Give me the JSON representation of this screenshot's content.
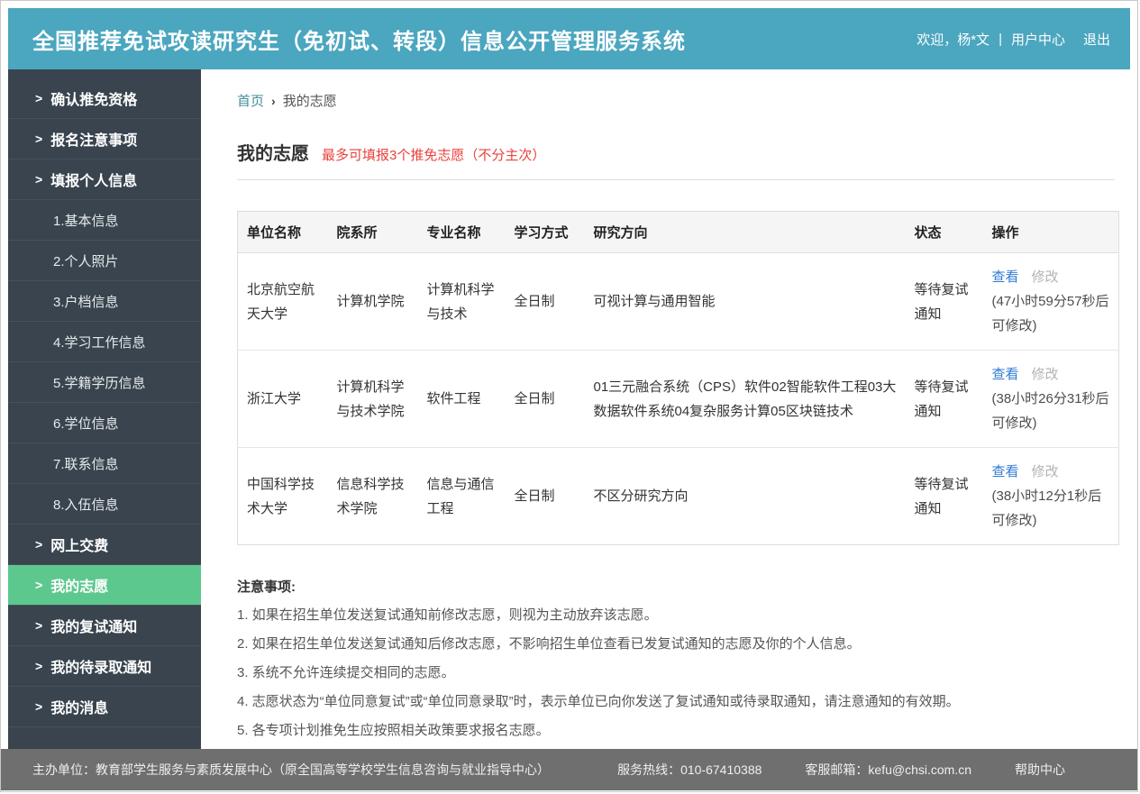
{
  "header": {
    "title": "全国推荐免试攻读研究生（免初试、转段）信息公开管理服务系统",
    "welcome": "欢迎，杨*文",
    "separator": "|",
    "user_center": "用户中心",
    "logout": "退出"
  },
  "sidebar": {
    "arrow": ">",
    "items": [
      {
        "label": "确认推免资格",
        "type": "top",
        "active": false
      },
      {
        "label": "报名注意事项",
        "type": "top",
        "active": false
      },
      {
        "label": "填报个人信息",
        "type": "top",
        "active": false
      },
      {
        "label": "1.基本信息",
        "type": "sub",
        "active": false
      },
      {
        "label": "2.个人照片",
        "type": "sub",
        "active": false
      },
      {
        "label": "3.户档信息",
        "type": "sub",
        "active": false
      },
      {
        "label": "4.学习工作信息",
        "type": "sub",
        "active": false
      },
      {
        "label": "5.学籍学历信息",
        "type": "sub",
        "active": false
      },
      {
        "label": "6.学位信息",
        "type": "sub",
        "active": false
      },
      {
        "label": "7.联系信息",
        "type": "sub",
        "active": false
      },
      {
        "label": "8.入伍信息",
        "type": "sub",
        "active": false
      },
      {
        "label": "网上交费",
        "type": "top",
        "active": false
      },
      {
        "label": "我的志愿",
        "type": "top",
        "active": true
      },
      {
        "label": "我的复试通知",
        "type": "top",
        "active": false
      },
      {
        "label": "我的待录取通知",
        "type": "top",
        "active": false
      },
      {
        "label": "我的消息",
        "type": "top",
        "active": false
      }
    ]
  },
  "breadcrumb": {
    "home": "首页",
    "separator": "›",
    "current": "我的志愿"
  },
  "page": {
    "title": "我的志愿",
    "notice": "最多可填报3个推免志愿（不分主次）"
  },
  "table": {
    "headers": [
      "单位名称",
      "院系所",
      "专业名称",
      "学习方式",
      "研究方向",
      "状态",
      "操作"
    ],
    "rows": [
      {
        "unit": "北京航空航天大学",
        "department": "计算机学院",
        "major": "计算机科学与技术",
        "mode": "全日制",
        "direction": "可视计算与通用智能",
        "status": "等待复试通知",
        "view": "查看",
        "modify": "修改",
        "countdown": "(47小时59分57秒后可修改)"
      },
      {
        "unit": "浙江大学",
        "department": "计算机科学与技术学院",
        "major": "软件工程",
        "mode": "全日制",
        "direction": "01三元融合系统（CPS）软件02智能软件工程03大数据软件系统04复杂服务计算05区块链技术",
        "status": "等待复试通知",
        "view": "查看",
        "modify": "修改",
        "countdown": "(38小时26分31秒后可修改)"
      },
      {
        "unit": "中国科学技术大学",
        "department": "信息科学技术学院",
        "major": "信息与通信工程",
        "mode": "全日制",
        "direction": "不区分研究方向",
        "status": "等待复试通知",
        "view": "查看",
        "modify": "修改",
        "countdown": "(38小时12分1秒后可修改)"
      }
    ]
  },
  "notes": {
    "title": "注意事项:",
    "items": [
      "1. 如果在招生单位发送复试通知前修改志愿，则视为主动放弃该志愿。",
      "2. 如果在招生单位发送复试通知后修改志愿，不影响招生单位查看已发复试通知的志愿及你的个人信息。",
      "3. 系统不允许连续提交相同的志愿。",
      "4. 志愿状态为“单位同意复试”或“单位同意录取”时，表示单位已向你发送了复试通知或待录取通知，请注意通知的有效期。",
      "5. 各专项计划推免生应按照相关政策要求报名志愿。"
    ]
  },
  "footer": {
    "organizer": "主办单位：教育部学生服务与素质发展中心（原全国高等学校学生信息咨询与就业指导中心）",
    "hotline_label": "服务热线：",
    "hotline": "010-67410388",
    "email_label": "客服邮箱：",
    "email": "kefu@chsi.com.cn",
    "help": "帮助中心"
  },
  "colors": {
    "header_bg": "#4BA6BF",
    "sidebar_bg": "#39444E",
    "active_item_green": "#5DC88E",
    "footer_bg": "#6F6F6F",
    "link_blue": "#2F7BD3",
    "notice_red": "#E9413C",
    "breadcrumb_link_teal": "#438D96",
    "disabled_link_gray": "#B3B3B3"
  }
}
